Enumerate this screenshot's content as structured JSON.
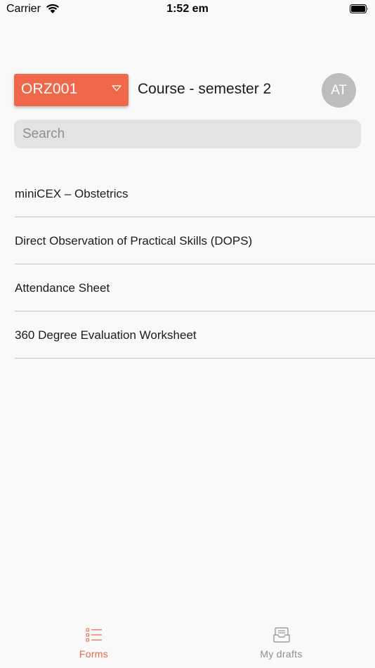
{
  "status_bar": {
    "carrier": "Carrier",
    "time": "1:52 em"
  },
  "header": {
    "course_code": "ORZ001",
    "course_name": "Course - semester 2",
    "avatar_initials": "AT"
  },
  "search": {
    "placeholder": "Search",
    "value": ""
  },
  "forms": [
    "miniCEX – Obstetrics",
    "Direct Observation of Practical Skills (DOPS)",
    "Attendance Sheet",
    "360 Degree Evaluation Worksheet"
  ],
  "tabs": [
    {
      "label": "Forms",
      "icon": "list-icon",
      "active": true
    },
    {
      "label": "My drafts",
      "icon": "inbox-tray-icon",
      "active": false
    }
  ],
  "colors": {
    "accent": "#f0684a",
    "avatar_bg": "#bdbdbd",
    "inactive_tab": "#8e8e93"
  }
}
